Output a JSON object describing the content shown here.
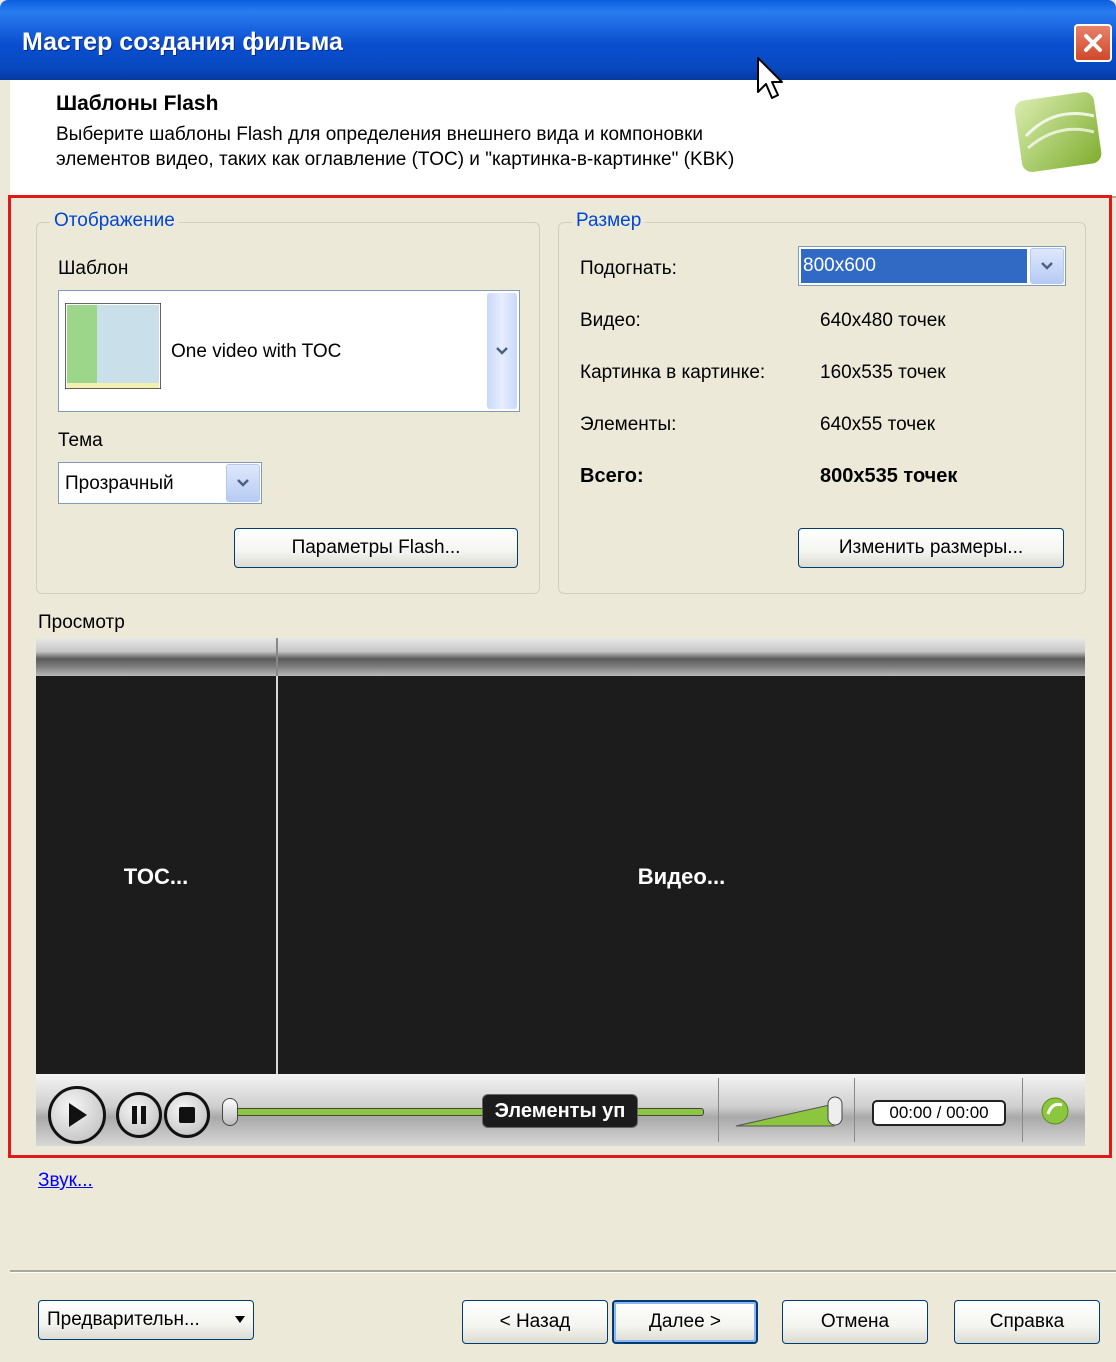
{
  "window": {
    "title": "Мастер создания фильма"
  },
  "header": {
    "title": "Шаблоны Flash",
    "description": "Выберите шаблоны Flash для определения внешнего вида и компоновки элементов видео, таких как оглавление (TOC) и \"картинка-в-картинке\" (KBK)"
  },
  "display": {
    "group_title": "Отображение",
    "template_label": "Шаблон",
    "template_value": "One video with TOC",
    "theme_label": "Тема",
    "theme_value": "Прозрачный",
    "flash_params_button": "Параметры Flash..."
  },
  "size": {
    "group_title": "Размер",
    "fit_label": "Подогнать:",
    "fit_value": "800x600",
    "rows": [
      {
        "label": "Видео:",
        "value": "640x480 точек"
      },
      {
        "label": "Картинка в картинке:",
        "value": "160x535 точек"
      },
      {
        "label": "Элементы:",
        "value": "640x55 точек"
      }
    ],
    "total_label": "Всего:",
    "total_value": "800x535 точек",
    "resize_button": "Изменить размеры..."
  },
  "preview": {
    "label": "Просмотр",
    "toc_text": "TOC...",
    "video_text": "Видео...",
    "controls_text": "Элементы уп",
    "time_text": "00:00 / 00:00",
    "accent_color": "#8cc63f"
  },
  "sound_link": "Звук...",
  "footer": {
    "preview_button": "Предварительн...",
    "back_button": "< Назад",
    "next_button": "Далее >",
    "cancel_button": "Отмена",
    "help_button": "Справка"
  }
}
